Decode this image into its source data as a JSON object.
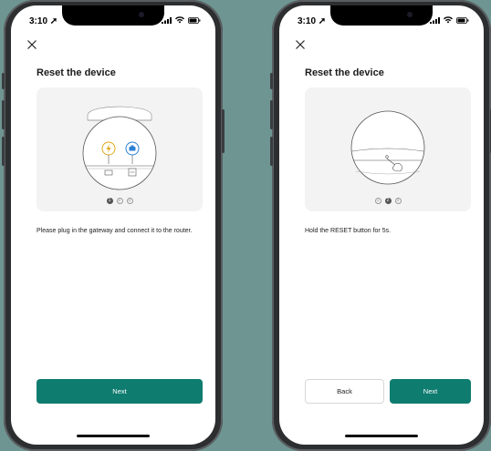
{
  "colors": {
    "accent": "#0e7c6f",
    "background": "#6e9592"
  },
  "screens": [
    {
      "status_time": "3:10",
      "close_icon": "close-icon",
      "title": "Reset the device",
      "pager": [
        "1",
        "2",
        "3"
      ],
      "active_step": 1,
      "instruction": "Please plug in the gateway and connect it to the router.",
      "next_label": "Next"
    },
    {
      "status_time": "3:10",
      "close_icon": "close-icon",
      "title": "Reset the device",
      "pager": [
        "1",
        "2",
        "3"
      ],
      "active_step": 2,
      "instruction": "Hold the RESET button for 5s.",
      "back_label": "Back",
      "next_label": "Next"
    }
  ]
}
